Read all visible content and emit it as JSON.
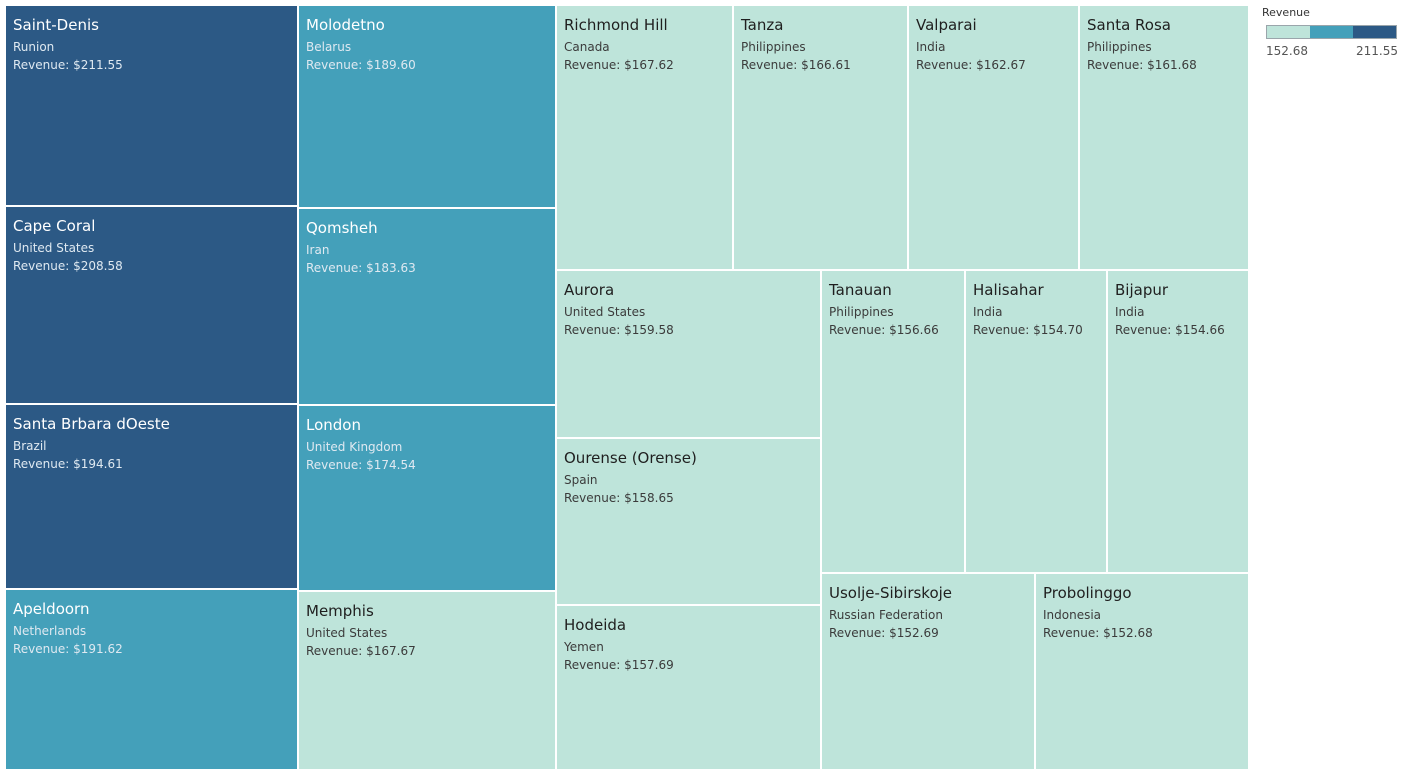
{
  "chart_data": {
    "type": "treemap",
    "measure": "Revenue",
    "items": [
      {
        "city": "Saint-Denis",
        "country": "Runion",
        "revenue_label": "Revenue: $211.55",
        "revenue": 211.55,
        "color": "#2c5985"
      },
      {
        "city": "Cape Coral",
        "country": "United States",
        "revenue_label": "Revenue: $208.58",
        "revenue": 208.58,
        "color": "#2c5985"
      },
      {
        "city": "Santa Brbara dOeste",
        "country": "Brazil",
        "revenue_label": "Revenue: $194.61",
        "revenue": 194.61,
        "color": "#2c5985"
      },
      {
        "city": "Apeldoorn",
        "country": "Netherlands",
        "revenue_label": "Revenue: $191.62",
        "revenue": 191.62,
        "color": "#44a0ba"
      },
      {
        "city": "Molodetno",
        "country": "Belarus",
        "revenue_label": "Revenue: $189.60",
        "revenue": 189.6,
        "color": "#44a0ba"
      },
      {
        "city": "Qomsheh",
        "country": "Iran",
        "revenue_label": "Revenue: $183.63",
        "revenue": 183.63,
        "color": "#44a0ba"
      },
      {
        "city": "London",
        "country": "United Kingdom",
        "revenue_label": "Revenue: $174.54",
        "revenue": 174.54,
        "color": "#44a0ba"
      },
      {
        "city": "Memphis",
        "country": "United States",
        "revenue_label": "Revenue: $167.67",
        "revenue": 167.67,
        "color": "#bee4da"
      },
      {
        "city": "Richmond Hill",
        "country": "Canada",
        "revenue_label": "Revenue: $167.62",
        "revenue": 167.62,
        "color": "#bee4da"
      },
      {
        "city": "Tanza",
        "country": "Philippines",
        "revenue_label": "Revenue: $166.61",
        "revenue": 166.61,
        "color": "#bee4da"
      },
      {
        "city": "Valparai",
        "country": "India",
        "revenue_label": "Revenue: $162.67",
        "revenue": 162.67,
        "color": "#bee4da"
      },
      {
        "city": "Santa Rosa",
        "country": "Philippines",
        "revenue_label": "Revenue: $161.68",
        "revenue": 161.68,
        "color": "#bee4da"
      },
      {
        "city": "Aurora",
        "country": "United States",
        "revenue_label": "Revenue: $159.58",
        "revenue": 159.58,
        "color": "#bee4da"
      },
      {
        "city": "Ourense (Orense)",
        "country": "Spain",
        "revenue_label": "Revenue: $158.65",
        "revenue": 158.65,
        "color": "#bee4da"
      },
      {
        "city": "Hodeida",
        "country": "Yemen",
        "revenue_label": "Revenue: $157.69",
        "revenue": 157.69,
        "color": "#bee4da"
      },
      {
        "city": "Tanauan",
        "country": "Philippines",
        "revenue_label": "Revenue: $156.66",
        "revenue": 156.66,
        "color": "#bee4da"
      },
      {
        "city": "Halisahar",
        "country": "India",
        "revenue_label": "Revenue: $154.70",
        "revenue": 154.7,
        "color": "#bee4da"
      },
      {
        "city": "Bijapur",
        "country": "India",
        "revenue_label": "Revenue: $154.66",
        "revenue": 154.66,
        "color": "#bee4da"
      },
      {
        "city": "Usolje-Sibirskoje",
        "country": "Russian Federation",
        "revenue_label": "Revenue: $152.69",
        "revenue": 152.69,
        "color": "#bee4da"
      },
      {
        "city": "Probolinggo",
        "country": "Indonesia",
        "revenue_label": "Revenue: $152.68",
        "revenue": 152.68,
        "color": "#bee4da"
      }
    ],
    "legend": {
      "title": "Revenue",
      "min_label": "152.68",
      "max_label": "211.55",
      "colors": [
        "#bee4da",
        "#44a0ba",
        "#2c5985"
      ]
    }
  }
}
